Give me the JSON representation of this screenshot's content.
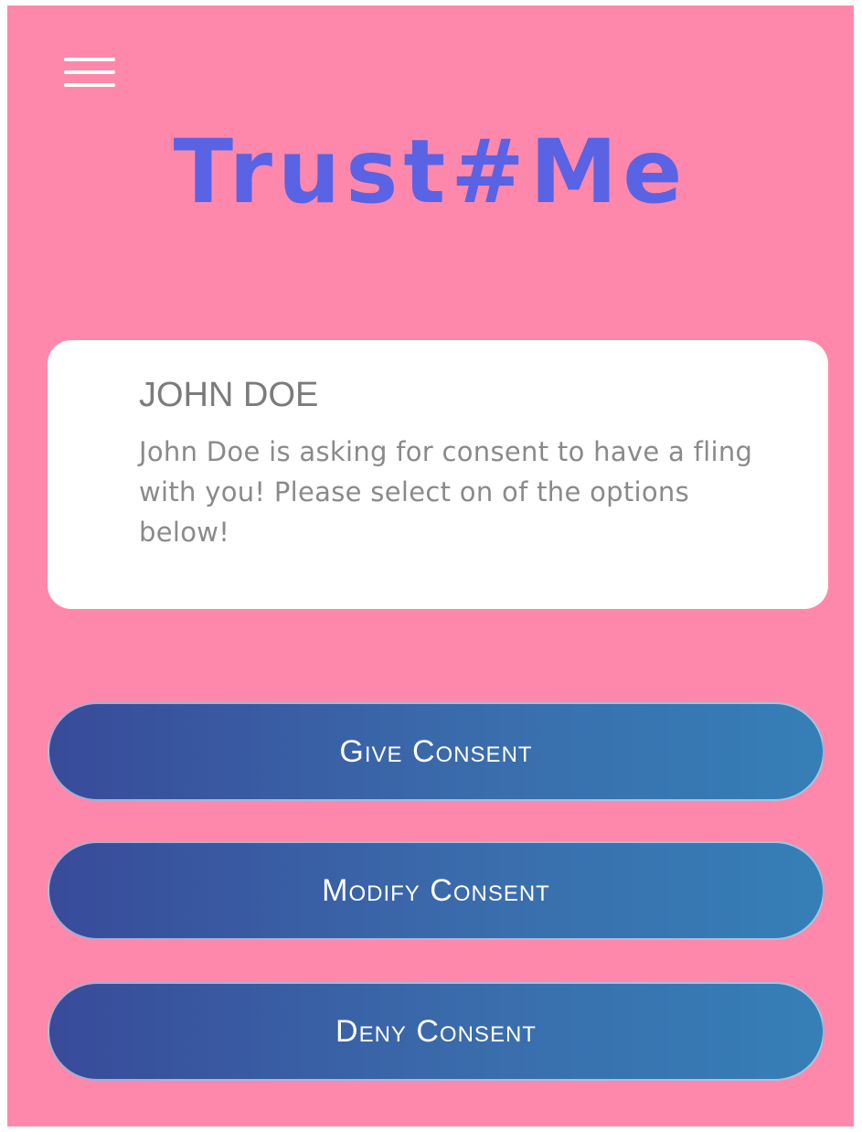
{
  "header": {
    "menu_icon": "hamburger-menu-icon",
    "logo_text": "Trust#Me"
  },
  "request_card": {
    "name": "JOHN DOE",
    "message": "John Doe is asking for consent to have a fling with you! Please select on of the options below!"
  },
  "actions": {
    "give_label": "Give Consent",
    "modify_label": "Modify Consent",
    "deny_label": "Deny Consent"
  },
  "colors": {
    "background": "#fe88ab",
    "logo": "#5963e4",
    "button_gradient_start": "#384b9a",
    "button_gradient_end": "#357fb7",
    "card_text": "#7b7b7b"
  }
}
